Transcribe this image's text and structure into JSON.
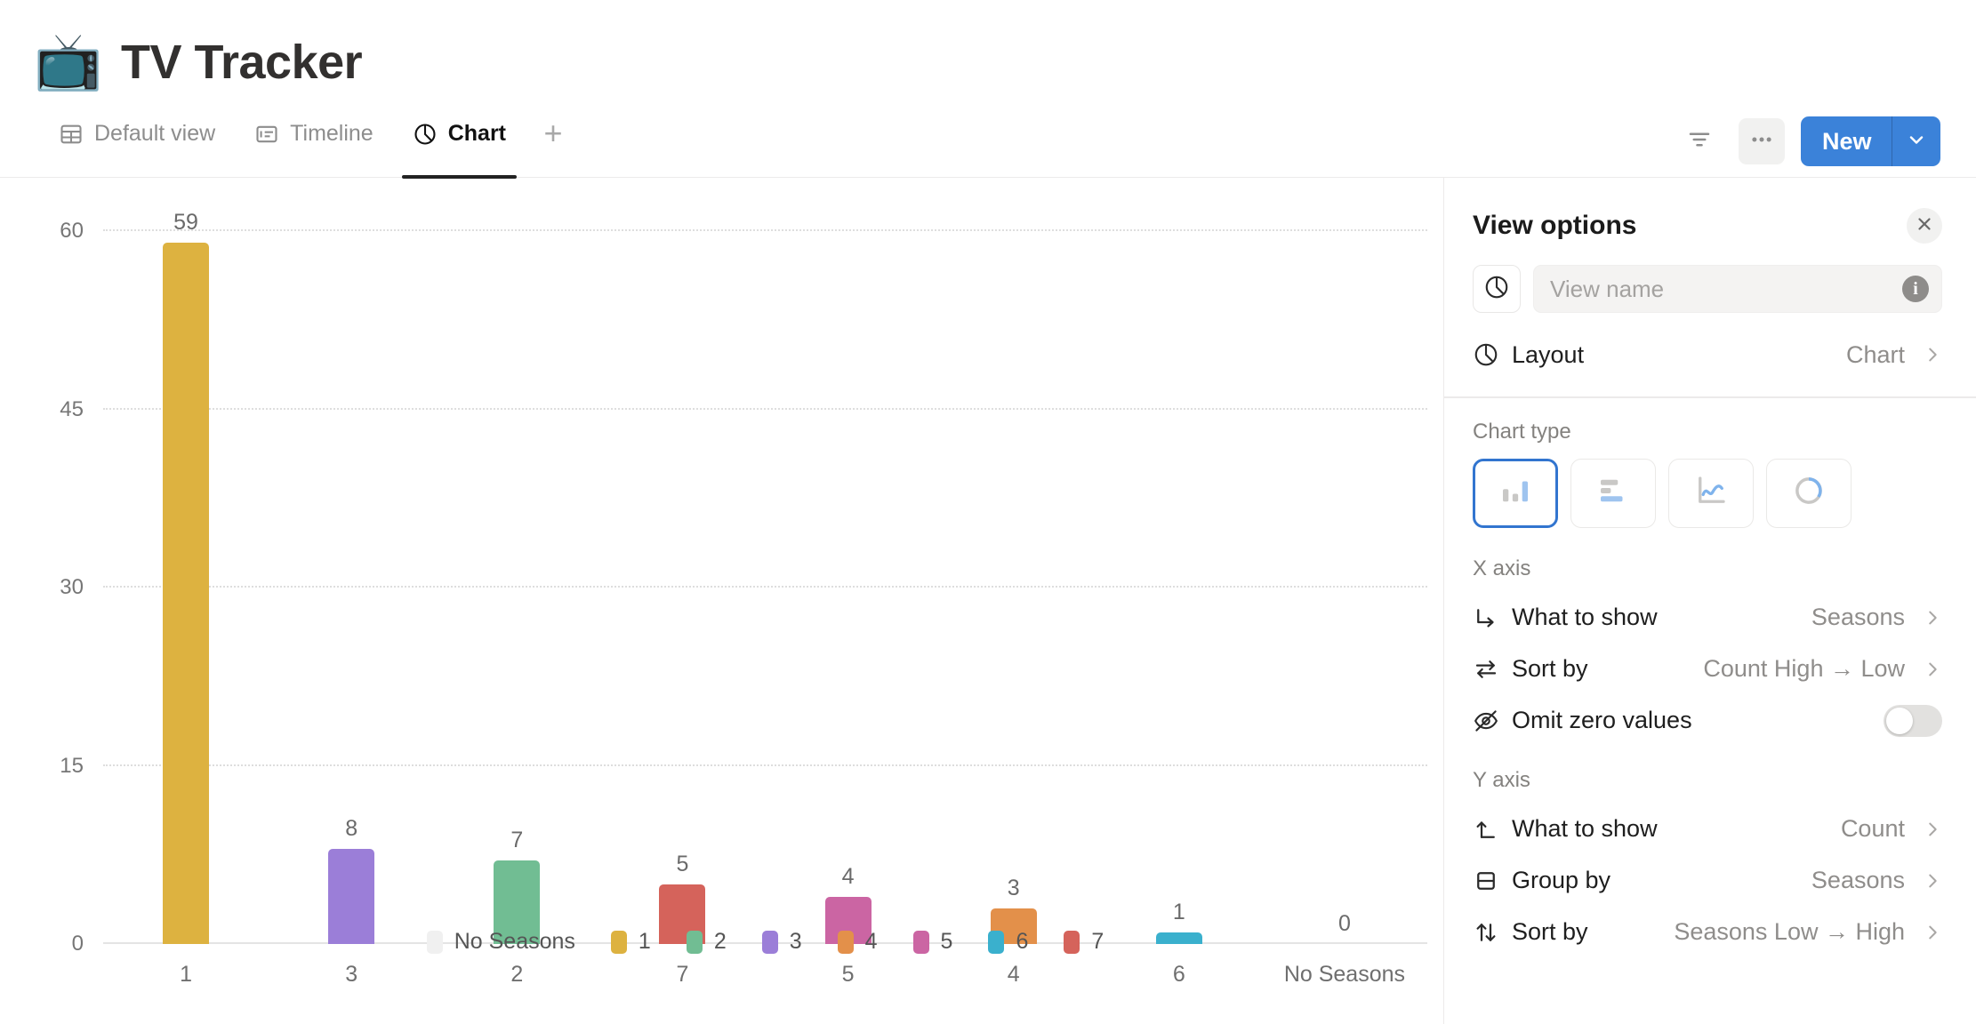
{
  "header": {
    "emoji": "📺",
    "emoji_name": "television-emoji",
    "title": "TV Tracker"
  },
  "tabs": [
    {
      "label": "Default view",
      "icon": "table-icon",
      "active": false
    },
    {
      "label": "Timeline",
      "icon": "timeline-icon",
      "active": false
    },
    {
      "label": "Chart",
      "icon": "pie-chart-icon",
      "active": true
    }
  ],
  "tab_add_label": "+",
  "toolbar": {
    "filter_icon": "filter-icon",
    "more_icon": "more-options-icon",
    "new_label": "New",
    "new_caret_icon": "chevron-down-icon",
    "accent_color": "#3b82d9"
  },
  "chart_data": {
    "type": "bar",
    "title": "",
    "xlabel": "",
    "ylabel": "",
    "ylim": [
      0,
      60
    ],
    "yticks": [
      0,
      15,
      30,
      45,
      60
    ],
    "ytick_labels": [
      "0",
      "15",
      "30",
      "45",
      "60"
    ],
    "grid": true,
    "categories": [
      "1",
      "3",
      "2",
      "7",
      "5",
      "4",
      "6",
      "No Seasons"
    ],
    "values": [
      59,
      8,
      7,
      5,
      4,
      3,
      1,
      0
    ],
    "value_labels": [
      "59",
      "8",
      "7",
      "5",
      "4",
      "3",
      "1",
      "0"
    ],
    "bar_colors": [
      "#ddb240",
      "#9b7ed8",
      "#71bd93",
      "#d5635b",
      "#cb65a3",
      "#e3904a",
      "#3ab0cd",
      "#f0f0f0"
    ],
    "legend_position": "bottom",
    "legend": [
      {
        "label": "No Seasons",
        "color": "#f0f0f0"
      },
      {
        "label": "1",
        "color": "#ddb240"
      },
      {
        "label": "2",
        "color": "#71bd93"
      },
      {
        "label": "3",
        "color": "#9b7ed8"
      },
      {
        "label": "4",
        "color": "#e3904a"
      },
      {
        "label": "5",
        "color": "#cb65a3"
      },
      {
        "label": "6",
        "color": "#3ab0cd"
      },
      {
        "label": "7",
        "color": "#d5635b"
      }
    ]
  },
  "panel": {
    "title": "View options",
    "close_icon": "close-icon",
    "view_name": {
      "value": "",
      "placeholder": "View name",
      "leading_icon": "pie-chart-icon",
      "info_icon": "info-icon"
    },
    "layout_row": {
      "icon": "pie-chart-icon",
      "label": "Layout",
      "value": "Chart",
      "chevron": "chevron-right-icon"
    },
    "chart_type": {
      "section_label": "Chart type",
      "options": [
        {
          "name": "bar-chart-type",
          "selected": true
        },
        {
          "name": "horizontal-bar-chart-type",
          "selected": false
        },
        {
          "name": "line-chart-type",
          "selected": false
        },
        {
          "name": "donut-chart-type",
          "selected": false
        }
      ]
    },
    "x_axis": {
      "section_label": "X axis",
      "rows": [
        {
          "icon": "arrow-corner-icon",
          "label": "What to show",
          "value": "Seasons",
          "type": "nav"
        },
        {
          "icon": "sort-swap-icon",
          "label": "Sort by",
          "value": "Count High → Low",
          "type": "nav"
        },
        {
          "icon": "eye-off-icon",
          "label": "Omit zero values",
          "value": "",
          "type": "toggle",
          "toggle_on": false
        }
      ]
    },
    "y_axis": {
      "section_label": "Y axis",
      "rows": [
        {
          "icon": "arrow-up-corner-icon",
          "label": "What to show",
          "value": "Count",
          "type": "nav"
        },
        {
          "icon": "group-rows-icon",
          "label": "Group by",
          "value": "Seasons",
          "type": "nav"
        },
        {
          "icon": "sort-updown-icon",
          "label": "Sort by",
          "value": "Seasons Low → High",
          "type": "nav"
        }
      ]
    }
  }
}
